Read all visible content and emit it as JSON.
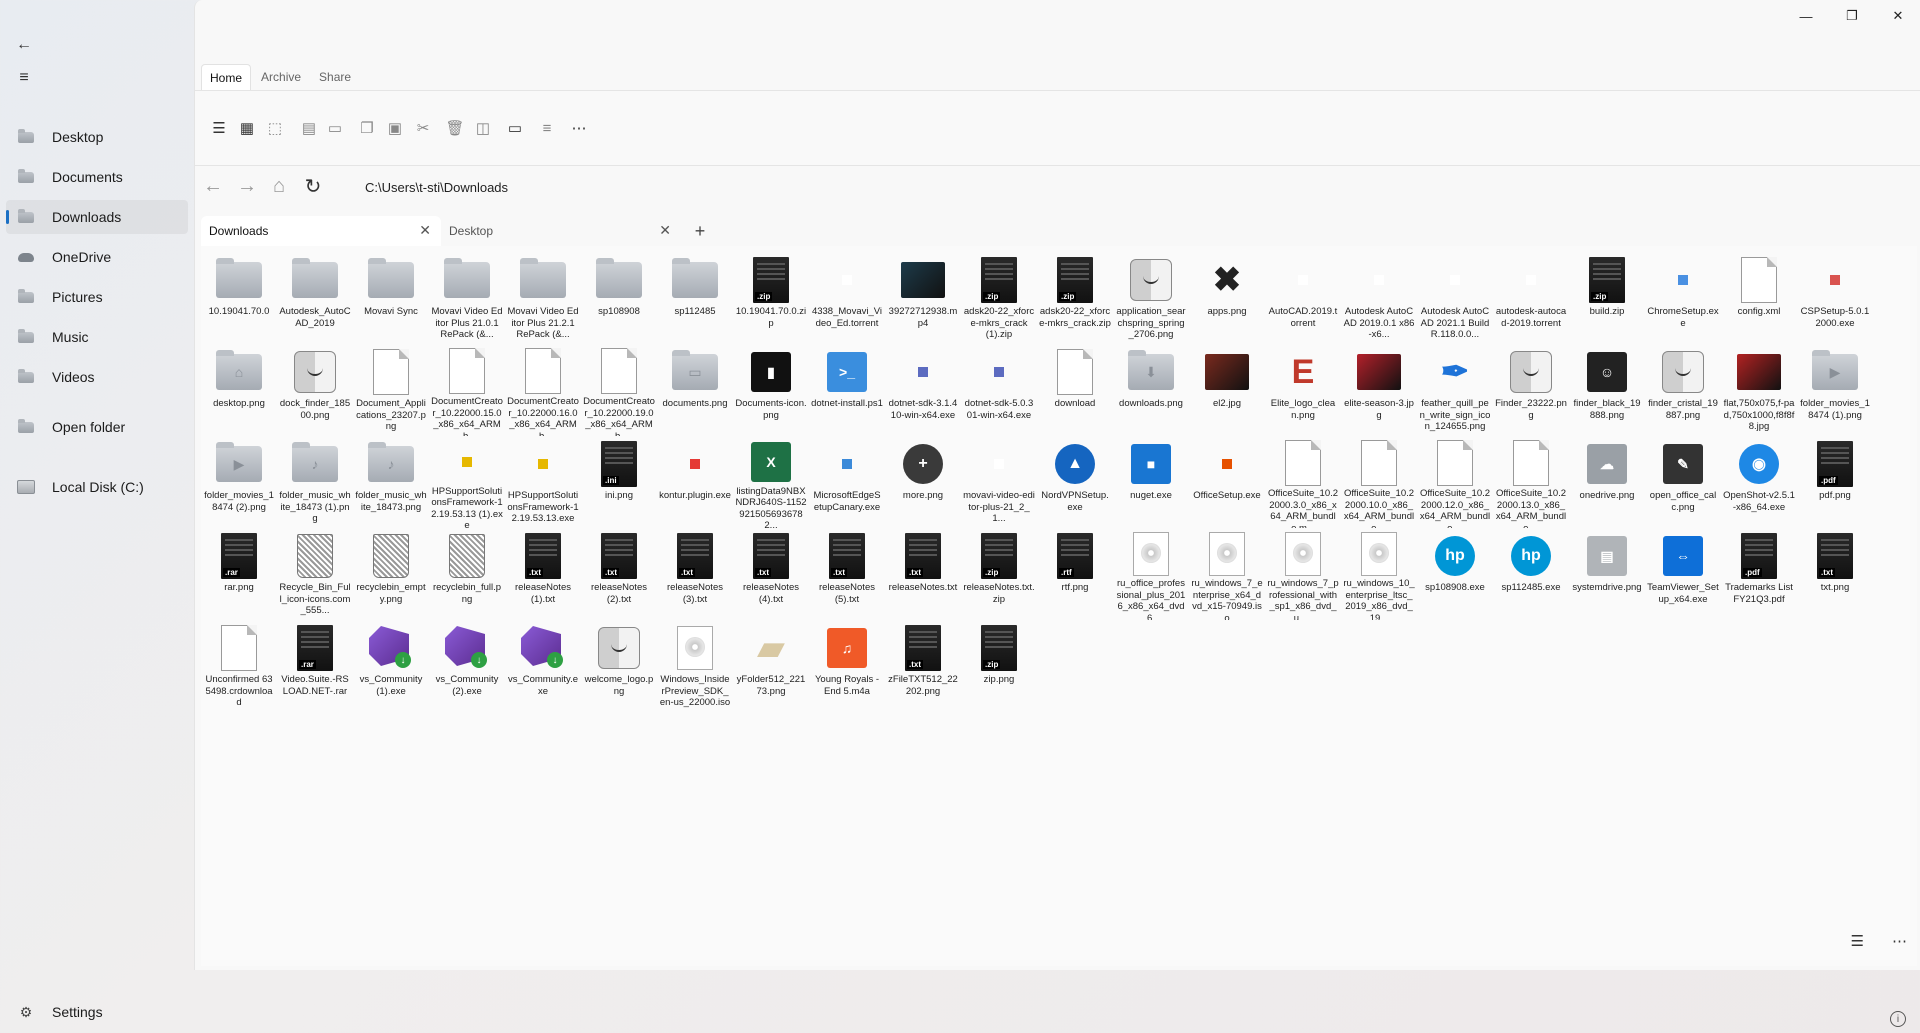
{
  "window": {
    "minimize": "—",
    "maximize": "❐",
    "close": "✕"
  },
  "nav": {
    "back_glyph": "←",
    "menu_glyph": "≡",
    "items": [
      {
        "label": "Desktop"
      },
      {
        "label": "Documents"
      },
      {
        "label": "Downloads"
      },
      {
        "label": "OneDrive"
      },
      {
        "label": "Pictures"
      },
      {
        "label": "Music"
      },
      {
        "label": "Videos"
      },
      {
        "label": "Open folder"
      },
      {
        "label": "Local Disk (C:)"
      }
    ],
    "settings_label": "Settings"
  },
  "ribbon": {
    "tabs": [
      "Home",
      "Archive",
      "Share"
    ]
  },
  "address": {
    "path": "C:\\Users\\t-sti\\Downloads"
  },
  "tabs": [
    {
      "label": "Downloads"
    },
    {
      "label": "Desktop"
    }
  ],
  "tab_close_glyph": "✕",
  "tab_add_glyph": "+",
  "files": [
    {
      "name": "10.19041.70.0",
      "icon": "folder-icon",
      "kind": "folder"
    },
    {
      "name": "Autodesk_AutoCAD_2019",
      "icon": "folder-icon",
      "kind": "folder"
    },
    {
      "name": "Movavi Sync",
      "icon": "folder-icon",
      "kind": "folder"
    },
    {
      "name": "Movavi Video Editor Plus 21.0.1 RePack (&...",
      "icon": "folder-icon",
      "kind": "folder"
    },
    {
      "name": "Movavi Video Editor Plus 21.2.1 RePack (&...",
      "icon": "folder-icon",
      "kind": "folder"
    },
    {
      "name": "sp108908",
      "icon": "folder-icon",
      "kind": "folder"
    },
    {
      "name": "sp112485",
      "icon": "folder-icon",
      "kind": "folder"
    },
    {
      "name": "10.19041.70.0.zip",
      "icon": "zip-icon",
      "kind": "black",
      "tag": ".zip"
    },
    {
      "name": "4338_Movavi_Video_Ed.torrent",
      "icon": "blank-icon",
      "kind": "small",
      "color": "#ffffff"
    },
    {
      "name": "39272712938.mp4",
      "icon": "video-thumbnail-icon",
      "kind": "photo",
      "color": "#1d3b4a"
    },
    {
      "name": "adsk20-22_xforce-mkrs_crack (1).zip",
      "icon": "zip-icon",
      "kind": "black",
      "tag": ".zip"
    },
    {
      "name": "adsk20-22_xforce-mkrs_crack.zip",
      "icon": "zip-icon",
      "kind": "black",
      "tag": ".zip"
    },
    {
      "name": "application_searchspring_spring_2706.png",
      "icon": "finder-icon",
      "kind": "finder"
    },
    {
      "name": "apps.png",
      "icon": "tools-icon",
      "kind": "glyph",
      "glyph": "✖",
      "color": "#222222"
    },
    {
      "name": "AutoCAD.2019.torrent",
      "icon": "blank-icon",
      "kind": "small",
      "color": "#ffffff"
    },
    {
      "name": "Autodesk AutoCAD 2019.0.1 x86-x6...",
      "icon": "blank-icon",
      "kind": "small",
      "color": "#ffffff"
    },
    {
      "name": "Autodesk AutoCAD 2021.1 Build R.118.0.0...",
      "icon": "blank-icon",
      "kind": "small",
      "color": "#ffffff"
    },
    {
      "name": "autodesk-autocad-2019.torrent",
      "icon": "blank-icon",
      "kind": "small",
      "color": "#ffffff"
    },
    {
      "name": "build.zip",
      "icon": "zip-icon",
      "kind": "black",
      "tag": ".zip"
    },
    {
      "name": "ChromeSetup.exe",
      "icon": "chrome-icon",
      "kind": "small",
      "color": "#4a90e2"
    },
    {
      "name": "config.xml",
      "icon": "document-icon",
      "kind": "doc"
    },
    {
      "name": "CSPSetup-5.0.12000.exe",
      "icon": "app-icon",
      "kind": "small",
      "color": "#d9534f"
    },
    {
      "name": "desktop.png",
      "icon": "home-folder-icon",
      "kind": "folder",
      "sym": "⌂"
    },
    {
      "name": "dock_finder_18500.png",
      "icon": "finder-icon",
      "kind": "finder"
    },
    {
      "name": "Document_Applications_23207.png",
      "icon": "document-icon",
      "kind": "doc"
    },
    {
      "name": "DocumentCreator_10.22000.15.0_x86_x64_ARM_b...",
      "icon": "document-icon",
      "kind": "doc"
    },
    {
      "name": "DocumentCreator_10.22000.16.0_x86_x64_ARM_b...",
      "icon": "document-icon",
      "kind": "doc"
    },
    {
      "name": "DocumentCreator_10.22000.19.0_x86_x64_ARM_b...",
      "icon": "document-icon",
      "kind": "doc"
    },
    {
      "name": "documents.png",
      "icon": "documents-folder-icon",
      "kind": "folder",
      "sym": "▭"
    },
    {
      "name": "Documents-icon.png",
      "icon": "trash-icon",
      "kind": "square",
      "color": "#111111",
      "glyph": "▮"
    },
    {
      "name": "dotnet-install.ps1",
      "icon": "powershell-icon",
      "kind": "square",
      "color": "#3a8ede",
      "glyph": ">_"
    },
    {
      "name": "dotnet-sdk-3.1.410-win-x64.exe",
      "icon": "app-icon",
      "kind": "small",
      "color": "#5c6bc0"
    },
    {
      "name": "dotnet-sdk-5.0.301-win-x64.exe",
      "icon": "app-icon",
      "kind": "small",
      "color": "#5c6bc0"
    },
    {
      "name": "download",
      "icon": "document-icon",
      "kind": "doc"
    },
    {
      "name": "downloads.png",
      "icon": "downloads-folder-icon",
      "kind": "folder",
      "sym": "⬇"
    },
    {
      "name": "el2.jpg",
      "icon": "photo-icon",
      "kind": "photo",
      "color": "#7a2a1e"
    },
    {
      "name": "Elite_logo_clean.png",
      "icon": "elite-logo-icon",
      "kind": "glyph",
      "glyph": "E",
      "color": "#c0392b"
    },
    {
      "name": "elite-season-3.jpg",
      "icon": "photo-icon",
      "kind": "photo",
      "color": "#b3202a"
    },
    {
      "name": "feather_quill_pen_write_sign_icon_124655.png",
      "icon": "feather-icon",
      "kind": "glyph",
      "glyph": "✒",
      "color": "#1e73d8"
    },
    {
      "name": "Finder_23222.png",
      "icon": "finder-icon",
      "kind": "finder"
    },
    {
      "name": "finder_black_19888.png",
      "icon": "finder-black-icon",
      "kind": "square",
      "color": "#222222",
      "glyph": "☺"
    },
    {
      "name": "finder_cristal_19887.png",
      "icon": "finder-icon",
      "kind": "finder"
    },
    {
      "name": "flat,750x075,f-pad,750x1000,f8f8f8.jpg",
      "icon": "photo-icon",
      "kind": "photo",
      "color": "#b22222"
    },
    {
      "name": "folder_movies_18474 (1).png",
      "icon": "movies-folder-icon",
      "kind": "folder",
      "sym": "▶"
    },
    {
      "name": "folder_movies_18474 (2).png",
      "icon": "movies-folder-icon",
      "kind": "folder",
      "sym": "▶"
    },
    {
      "name": "folder_music_white_18473 (1).png",
      "icon": "music-folder-icon",
      "kind": "folder",
      "sym": "♪"
    },
    {
      "name": "folder_music_white_18473.png",
      "icon": "music-folder-icon",
      "kind": "folder",
      "sym": "♪"
    },
    {
      "name": "HPSupportSolutionsFramework-12.19.53.13 (1).exe",
      "icon": "app-icon",
      "kind": "small",
      "color": "#e6b800"
    },
    {
      "name": "HPSupportSolutionsFramework-12.19.53.13.exe",
      "icon": "app-icon",
      "kind": "small",
      "color": "#e6b800"
    },
    {
      "name": "ini.png",
      "icon": "ini-icon",
      "kind": "black",
      "tag": ".ini"
    },
    {
      "name": "kontur.plugin.exe",
      "icon": "app-icon",
      "kind": "small",
      "color": "#e53935"
    },
    {
      "name": "listingData9NBXNDRJ640S-11529215056936782...",
      "icon": "excel-icon",
      "kind": "square",
      "color": "#1e7145",
      "glyph": "X"
    },
    {
      "name": "MicrosoftEdgeSetupCanary.exe",
      "icon": "edge-icon",
      "kind": "small",
      "color": "#3b8ad9"
    },
    {
      "name": "more.png",
      "icon": "plus-icon",
      "kind": "round",
      "color": "#3a3a3a",
      "glyph": "+"
    },
    {
      "name": "movavi-video-editor-plus-21_2_1...",
      "icon": "blank-icon",
      "kind": "small",
      "color": "#ffffff"
    },
    {
      "name": "NordVPNSetup.exe",
      "icon": "nordvpn-icon",
      "kind": "round",
      "color": "#1565c0",
      "glyph": "▲"
    },
    {
      "name": "nuget.exe",
      "icon": "nuget-icon",
      "kind": "square",
      "color": "#1976d2",
      "glyph": "■"
    },
    {
      "name": "OfficeSetup.exe",
      "icon": "office-icon",
      "kind": "small",
      "color": "#e65100"
    },
    {
      "name": "OfficeSuite_10.22000.3.0_x86_x64_ARM_bundle.m...",
      "icon": "document-icon",
      "kind": "doc"
    },
    {
      "name": "OfficeSuite_10.22000.10.0_x86_x64_ARM_bundle....",
      "icon": "document-icon",
      "kind": "doc"
    },
    {
      "name": "OfficeSuite_10.22000.12.0_x86_x64_ARM_bundle....",
      "icon": "document-icon",
      "kind": "doc"
    },
    {
      "name": "OfficeSuite_10.22000.13.0_x86_x64_ARM_bundle....",
      "icon": "document-icon",
      "kind": "doc"
    },
    {
      "name": "onedrive.png",
      "icon": "onedrive-icon",
      "kind": "square",
      "color": "#9aa0a6",
      "glyph": "☁"
    },
    {
      "name": "open_office_calc.png",
      "icon": "calc-icon",
      "kind": "square",
      "color": "#333333",
      "glyph": "✎"
    },
    {
      "name": "OpenShot-v2.5.1-x86_64.exe",
      "icon": "openshot-icon",
      "kind": "round",
      "color": "#1e88e5",
      "glyph": "◉"
    },
    {
      "name": "pdf.png",
      "icon": "pdf-icon",
      "kind": "black",
      "tag": ".pdf"
    },
    {
      "name": "rar.png",
      "icon": "rar-icon",
      "kind": "black",
      "tag": ".rar"
    },
    {
      "name": "Recycle_Bin_Full_icon-icons.com_555...",
      "icon": "recycle-bin-icon",
      "kind": "bin"
    },
    {
      "name": "recyclebin_empty.png",
      "icon": "recycle-bin-icon",
      "kind": "bin"
    },
    {
      "name": "recyclebin_full.png",
      "icon": "recycle-bin-icon",
      "kind": "bin"
    },
    {
      "name": "releaseNotes (1).txt",
      "icon": "txt-icon",
      "kind": "black",
      "tag": ".txt"
    },
    {
      "name": "releaseNotes (2).txt",
      "icon": "txt-icon",
      "kind": "black",
      "tag": ".txt"
    },
    {
      "name": "releaseNotes (3).txt",
      "icon": "txt-icon",
      "kind": "black",
      "tag": ".txt"
    },
    {
      "name": "releaseNotes (4).txt",
      "icon": "txt-icon",
      "kind": "black",
      "tag": ".txt"
    },
    {
      "name": "releaseNotes (5).txt",
      "icon": "txt-icon",
      "kind": "black",
      "tag": ".txt"
    },
    {
      "name": "releaseNotes.txt",
      "icon": "txt-icon",
      "kind": "black",
      "tag": ".txt"
    },
    {
      "name": "releaseNotes.txt.zip",
      "icon": "zip-icon",
      "kind": "black",
      "tag": ".zip"
    },
    {
      "name": "rtf.png",
      "icon": "rtf-icon",
      "kind": "black",
      "tag": ".rtf"
    },
    {
      "name": "ru_office_professional_plus_2016_x86_x64_dvd_6...",
      "icon": "disc-image-icon",
      "kind": "disc"
    },
    {
      "name": "ru_windows_7_enterprise_x64_dvd_x15-70949.iso",
      "icon": "disc-image-icon",
      "kind": "disc"
    },
    {
      "name": "ru_windows_7_professional_with_sp1_x86_dvd_u_...",
      "icon": "disc-image-icon",
      "kind": "disc"
    },
    {
      "name": "ru_windows_10_enterprise_ltsc_2019_x86_dvd_19...",
      "icon": "disc-image-icon",
      "kind": "disc"
    },
    {
      "name": "sp108908.exe",
      "icon": "hp-icon",
      "kind": "round",
      "color": "#0096d6",
      "glyph": "hp"
    },
    {
      "name": "sp112485.exe",
      "icon": "hp-icon",
      "kind": "round",
      "color": "#0096d6",
      "glyph": "hp"
    },
    {
      "name": "systemdrive.png",
      "icon": "drive-icon",
      "kind": "square",
      "color": "#b0b4b8",
      "glyph": "▤"
    },
    {
      "name": "TeamViewer_Setup_x64.exe",
      "icon": "teamviewer-icon",
      "kind": "square",
      "color": "#0e6fd8",
      "glyph": "⇔"
    },
    {
      "name": "Trademarks List FY21Q3.pdf",
      "icon": "pdf-icon",
      "kind": "black",
      "tag": ".pdf"
    },
    {
      "name": "txt.png",
      "icon": "txt-icon",
      "kind": "black",
      "tag": ".txt"
    },
    {
      "name": "Unconfirmed 635498.crdownload",
      "icon": "document-icon",
      "kind": "doc"
    },
    {
      "name": "Video.Suite.-RSLOAD.NET-.rar",
      "icon": "rar-icon",
      "kind": "black",
      "tag": ".rar"
    },
    {
      "name": "vs_Community (1).exe",
      "icon": "visual-studio-icon",
      "kind": "vs"
    },
    {
      "name": "vs_Community (2).exe",
      "icon": "visual-studio-icon",
      "kind": "vs"
    },
    {
      "name": "vs_Community.exe",
      "icon": "visual-studio-icon",
      "kind": "vs"
    },
    {
      "name": "welcome_logo.png",
      "icon": "finder-icon",
      "kind": "finder"
    },
    {
      "name": "Windows_InsiderPreview_SDK_en-us_22000.iso",
      "icon": "disc-image-icon",
      "kind": "disc"
    },
    {
      "name": "yFolder512_22173.png",
      "icon": "folder-icon",
      "kind": "glyph",
      "glyph": "▰",
      "color": "#d9c9a3"
    },
    {
      "name": "Young Royals - End 5.m4a",
      "icon": "guitar-icon",
      "kind": "square",
      "color": "#f05a28",
      "glyph": "♫"
    },
    {
      "name": "zFileTXT512_22202.png",
      "icon": "txt-icon",
      "kind": "black",
      "tag": ".txt"
    },
    {
      "name": "zip.png",
      "icon": "zip-icon",
      "kind": "black",
      "tag": ".zip"
    }
  ],
  "status": {
    "view_glyph": "☰",
    "more_glyph": "⋯"
  },
  "info_glyph": "i"
}
